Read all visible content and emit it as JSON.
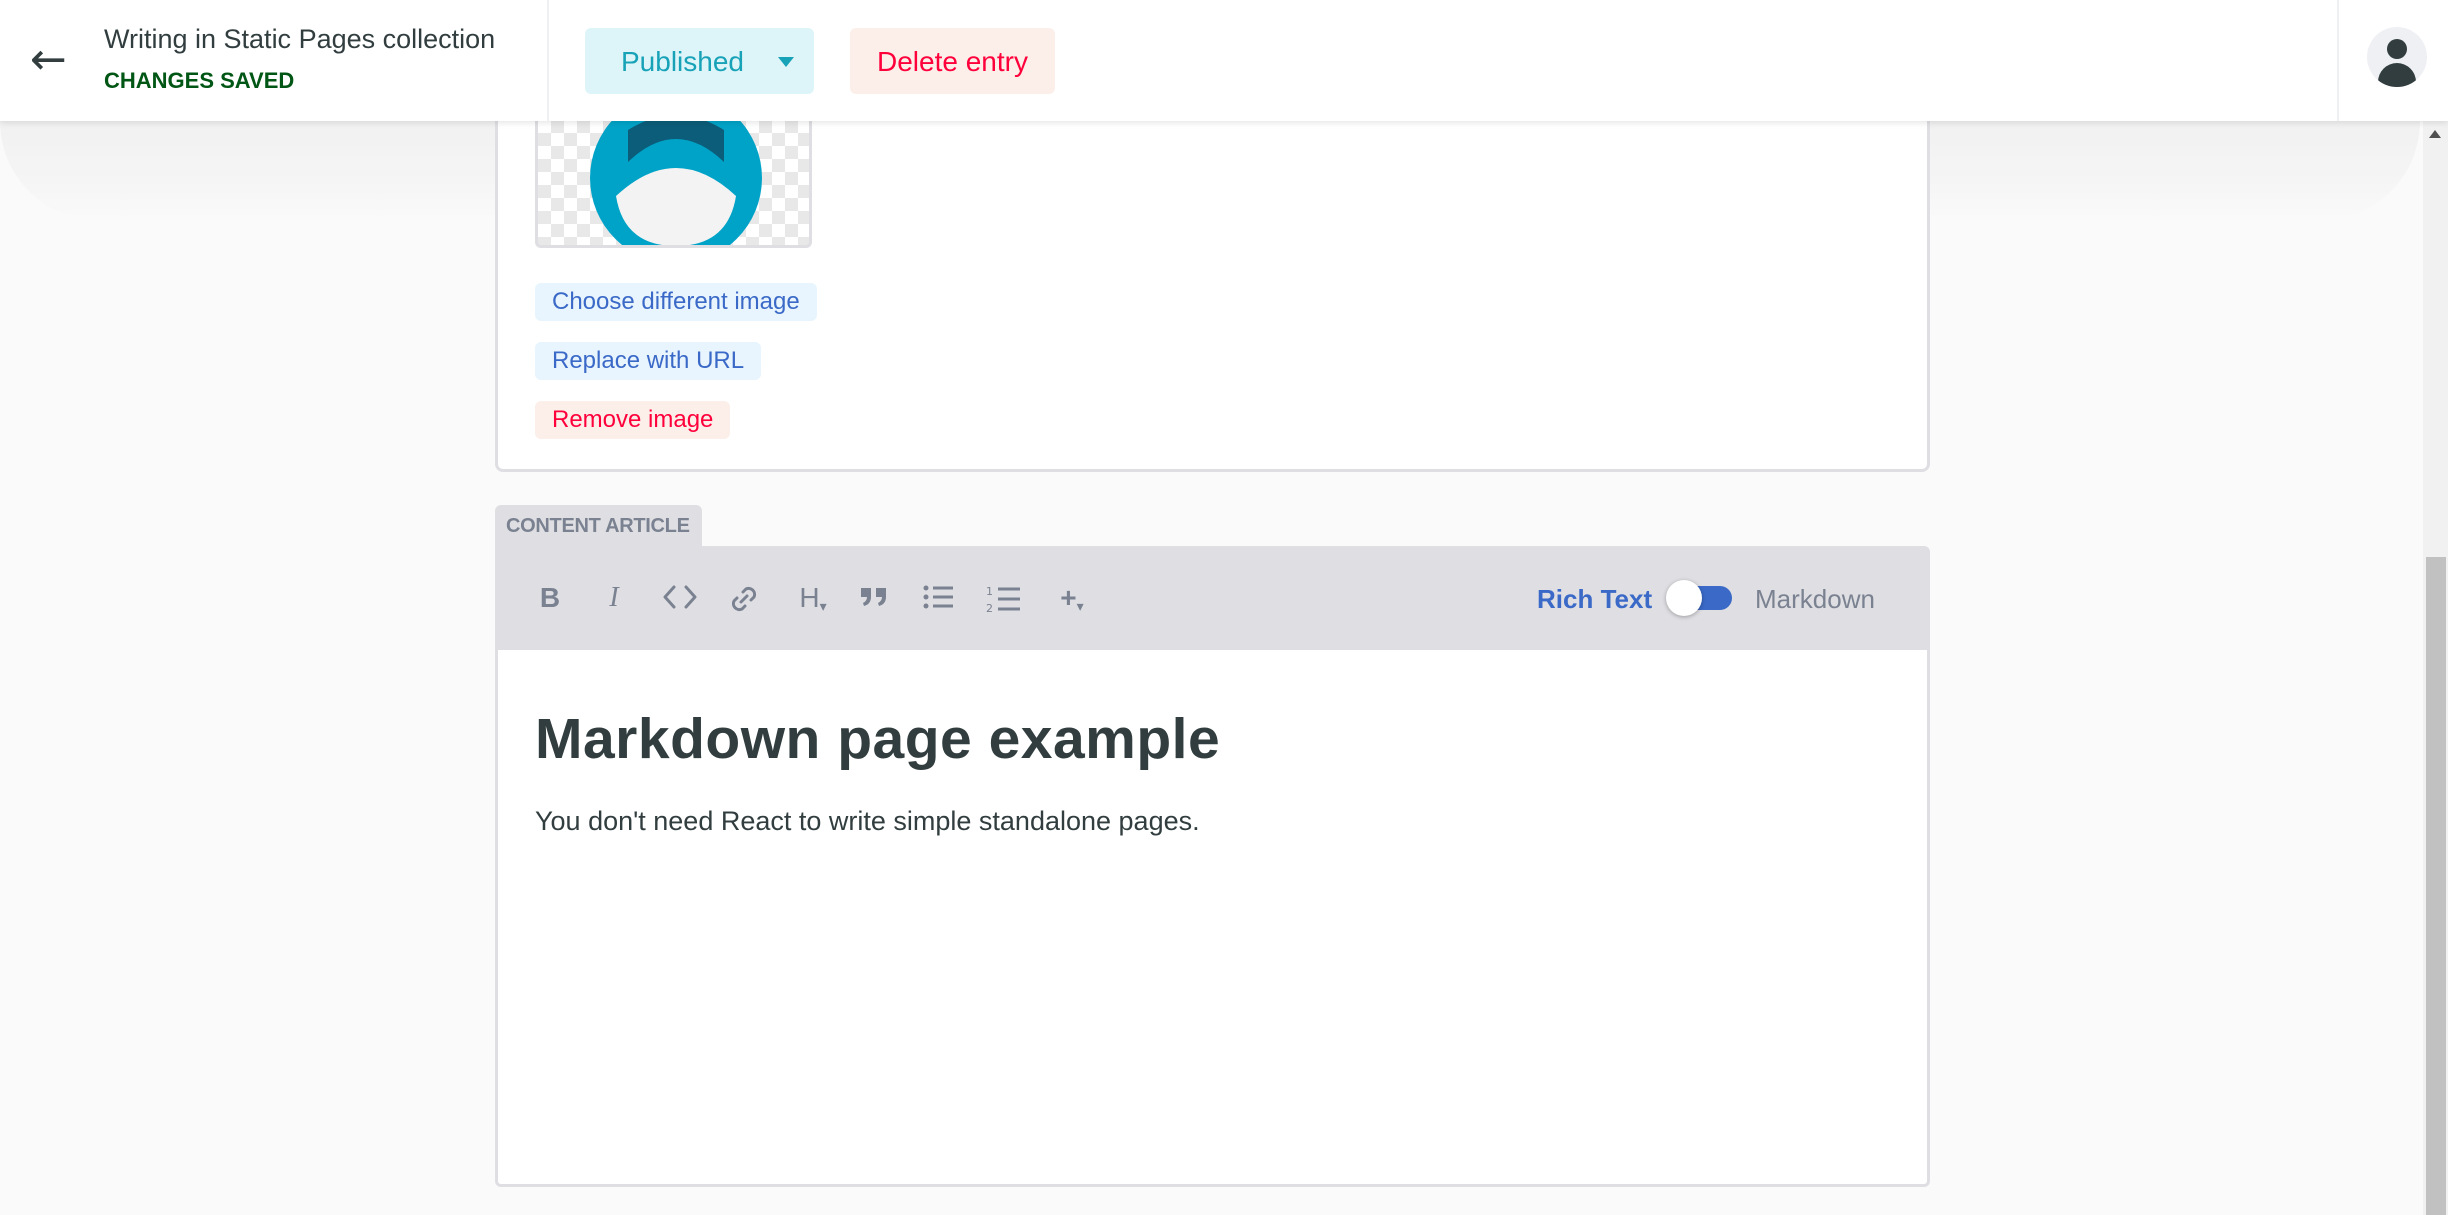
{
  "header": {
    "back_icon": "arrow-left-icon",
    "title": "Writing in Static Pages collection",
    "save_status": "CHANGES SAVED",
    "publish_status": "Published",
    "delete_label": "Delete entry",
    "avatar_icon": "user-avatar-icon"
  },
  "image_field": {
    "choose_label": "Choose different image",
    "replace_label": "Replace with URL",
    "remove_label": "Remove image"
  },
  "content_field": {
    "label": "CONTENT ARTICLE",
    "toolbar": {
      "bold": "B",
      "italic": "I",
      "code_icon": "code-icon",
      "link_icon": "link-icon",
      "heading": "H",
      "quote_icon": "quote-icon",
      "bulleted_list_icon": "bulleted-list-icon",
      "numbered_list_icon": "numbered-list-icon",
      "add": "+"
    },
    "mode_rich": "Rich Text",
    "mode_markdown": "Markdown",
    "mode_active": "Rich Text",
    "heading": "Markdown page example",
    "paragraph": "You don't need React to write simple standalone pages."
  },
  "colors": {
    "accent_blue": "#3a69c7",
    "published_teal": "#17a2b8",
    "danger_red": "#ff003b",
    "saved_green": "#005614"
  }
}
